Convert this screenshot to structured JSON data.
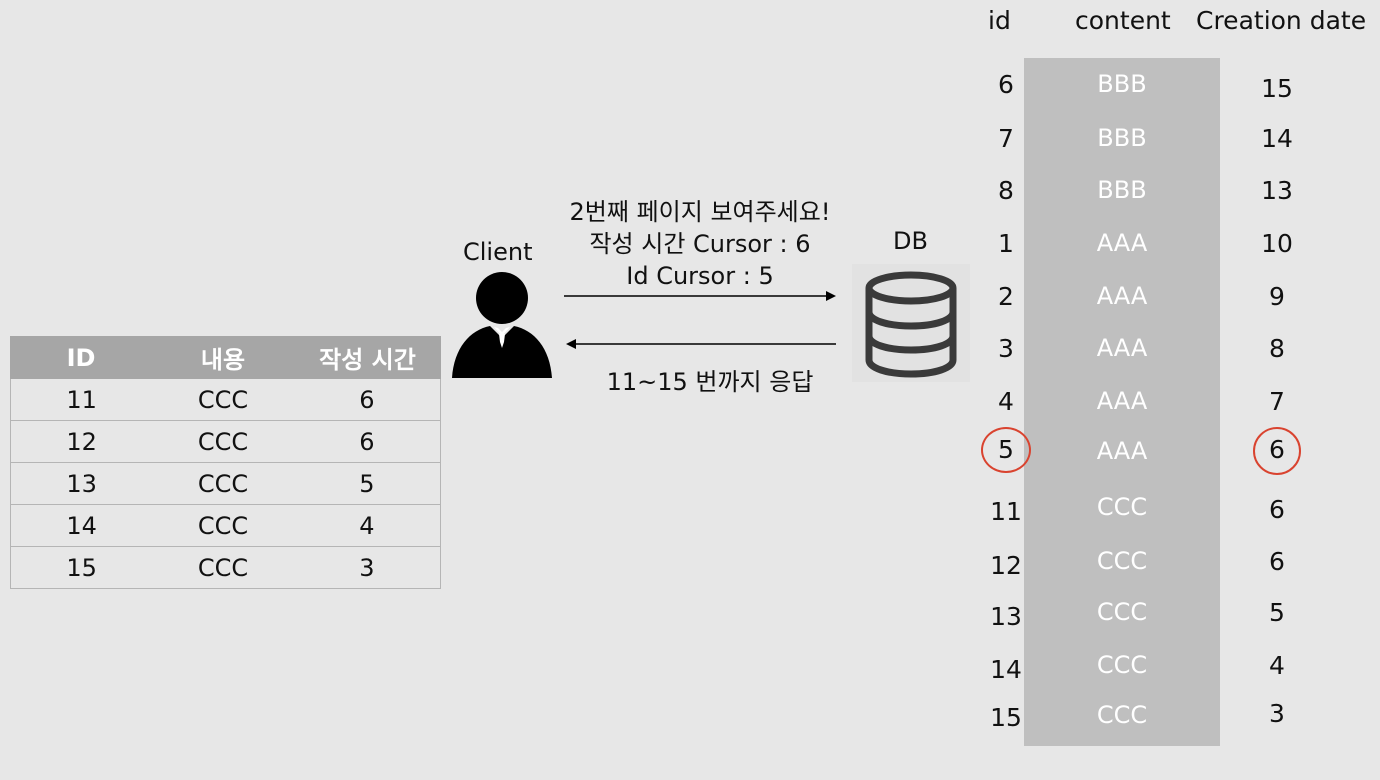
{
  "result_table": {
    "headers": [
      "ID",
      "내용",
      "작성 시간"
    ],
    "rows": [
      [
        "11",
        "CCC",
        "6"
      ],
      [
        "12",
        "CCC",
        "6"
      ],
      [
        "13",
        "CCC",
        "5"
      ],
      [
        "14",
        "CCC",
        "4"
      ],
      [
        "15",
        "CCC",
        "3"
      ]
    ]
  },
  "client": {
    "label": "Client"
  },
  "request": {
    "line1": "2번째 페이지 보여주세요!",
    "line2": "작성 시간 Cursor : 6",
    "line3": "Id Cursor : 5"
  },
  "response": {
    "text": "11~15 번까지 응답"
  },
  "db": {
    "label": "DB"
  },
  "db_table": {
    "headers": [
      "id",
      "content",
      "Creation date"
    ],
    "rows": [
      [
        "6",
        "BBB",
        "15"
      ],
      [
        "7",
        "BBB",
        "14"
      ],
      [
        "8",
        "BBB",
        "13"
      ],
      [
        "1",
        "AAA",
        "10"
      ],
      [
        "2",
        "AAA",
        "9"
      ],
      [
        "3",
        "AAA",
        "8"
      ],
      [
        "4",
        "AAA",
        "7"
      ],
      [
        "5",
        "AAA",
        "6"
      ],
      [
        "11",
        "CCC",
        "6"
      ],
      [
        "12",
        "CCC",
        "6"
      ],
      [
        "13",
        "CCC",
        "5"
      ],
      [
        "14",
        "CCC",
        "4"
      ],
      [
        "15",
        "CCC",
        "3"
      ]
    ],
    "highlighted_row": 7
  },
  "colors": {
    "highlight_circle": "#d9432f",
    "table_header": "#a6a6a6",
    "db_column": "#bfbfbf"
  }
}
